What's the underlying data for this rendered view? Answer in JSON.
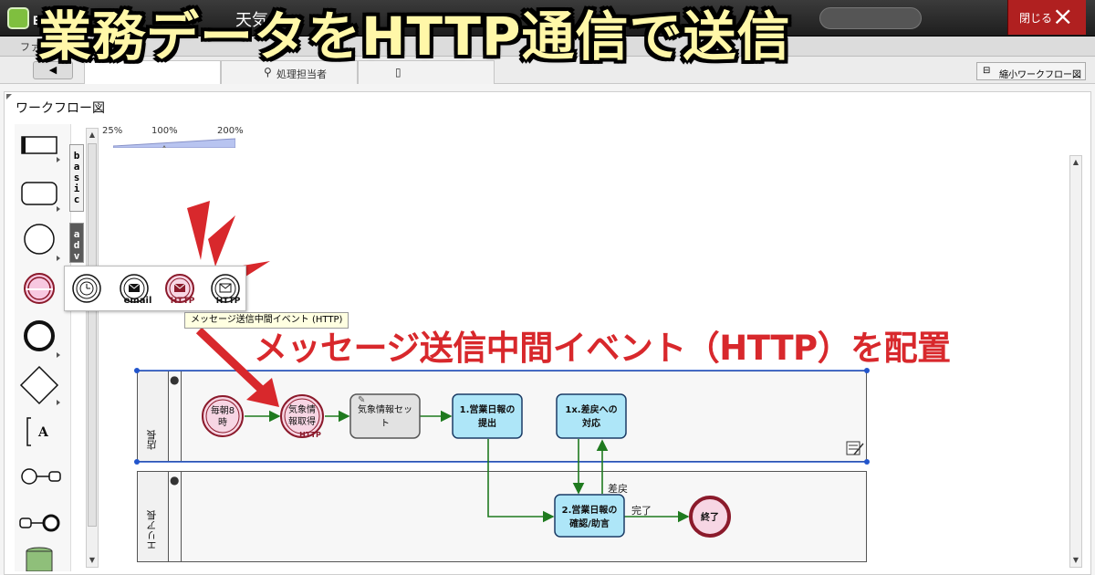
{
  "header": {
    "logo_text": "BP",
    "weather": "天気",
    "close_label": "閉じる",
    "close_icon": "×"
  },
  "menubar": {
    "file_label": "ファイ"
  },
  "tabs": [
    {
      "label": "",
      "icon": ""
    },
    {
      "label": "処理担当者",
      "icon": "person-icon"
    },
    {
      "label": "",
      "icon": "document-icon"
    }
  ],
  "toolbar": {
    "back_label": "◀",
    "shrink_label": "縮小ワークフロー図"
  },
  "headline": "業務データをHTTP通信で送信",
  "panel": {
    "title": "ワークフロー図"
  },
  "side_tabs": [
    "basic",
    "adva"
  ],
  "zoom": {
    "labels": [
      "25%",
      "100%",
      "200%"
    ],
    "value_percent": 100
  },
  "popup": {
    "items": [
      {
        "name": "timer-event",
        "label": ""
      },
      {
        "name": "email-event",
        "label": "email"
      },
      {
        "name": "http-message-event",
        "label": "HTTP"
      },
      {
        "name": "http-message-event-alt",
        "label": "HTTP"
      }
    ],
    "tooltip": "メッセージ送信中間イベント (HTTP)"
  },
  "caption": "メッセージ送信中間イベント（HTTP）を配置",
  "lanes": [
    {
      "name": "店長"
    },
    {
      "name": "エリア長"
    }
  ],
  "nodes": {
    "start": "毎朝8時",
    "weather_get_1": "気象情",
    "weather_get_2": "報取得",
    "weather_get_badge": "HTTP",
    "weather_set_1": "気象情報セッ",
    "weather_set_2": "ト",
    "daily_submit_1": "1.営業日報の",
    "daily_submit_2": "提出",
    "return_handle_1": "1x.差戻への",
    "return_handle_2": "対応",
    "review_1": "2.営業日報の",
    "review_2": "確認/助言",
    "end": "終了"
  },
  "edges": {
    "sendback": "差戻",
    "complete": "完了"
  },
  "colors": {
    "accent_red": "#d8282c",
    "headline_fill": "#fff7a8",
    "edge_green": "#1f7a1f",
    "task_blue": "#aee6f8",
    "event_maroon": "#8b1a2b"
  }
}
